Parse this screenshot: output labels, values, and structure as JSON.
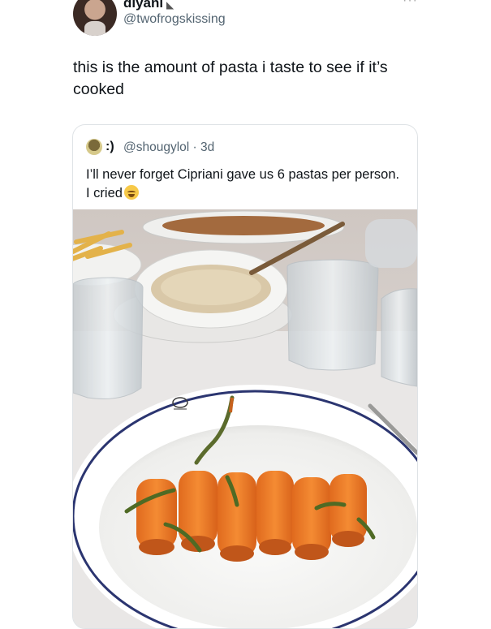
{
  "tweet": {
    "display_name": "diyani",
    "handle": "@twofrogskissing",
    "text": "this is the amount of pasta i taste to see if it’s cooked",
    "more_label": "···"
  },
  "quote": {
    "display_name": ":)",
    "handle": "@shougylol",
    "timestamp": "3d",
    "text": "I’ll never forget Cipriani gave us 6 pastas per person. I cried",
    "emoji": "sad-face-emoji"
  },
  "photo": {
    "subject": "plate-with-six-rigatoni",
    "pasta_count": 6
  }
}
